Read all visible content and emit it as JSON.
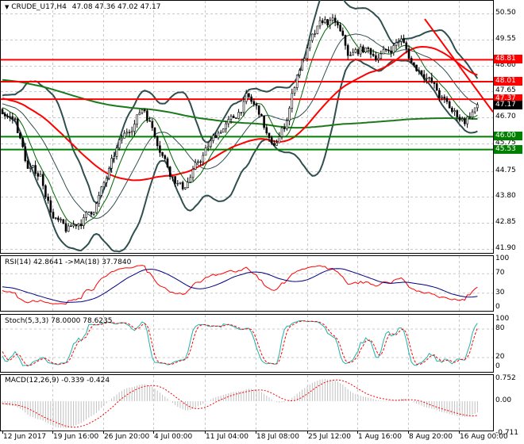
{
  "header": {
    "symbol": "CRUDE_U17,H4",
    "ohlc": "47.08 47.36 47.02 47.17",
    "menu_icon": "triangle-down-icon"
  },
  "price_axis": [
    "50.50",
    "49.55",
    "48.60",
    "47.65",
    "46.70",
    "45.75",
    "44.75",
    "43.80",
    "42.85",
    "41.90"
  ],
  "levels": [
    {
      "label": "48.81",
      "value": 48.81,
      "color": "#ff0000"
    },
    {
      "label": "48.01",
      "value": 48.01,
      "color": "#ff0000"
    },
    {
      "label": "47.37",
      "value": 47.37,
      "color": "#ff0000"
    },
    {
      "label": "46.00",
      "value": 46.0,
      "color": "#008000"
    },
    {
      "label": "45.53",
      "value": 45.53,
      "color": "#008000"
    }
  ],
  "current_price": {
    "label": "47.17",
    "value": 47.17
  },
  "rsi": {
    "title": "RSI(14) 42.8641  ->MA(18) 37.7840",
    "axis": [
      "100",
      "70",
      "30",
      "0"
    ]
  },
  "stoch": {
    "title": "Stoch(5,3,3) 78.0000 78.6235",
    "axis": [
      "100",
      "80",
      "20",
      "0"
    ]
  },
  "macd": {
    "title": "MACD(12,26,9) -0.339 -0.424",
    "axis": [
      "0.752",
      "0.00",
      "-0.711"
    ]
  },
  "time_axis": [
    "12 Jun 2017",
    "19 Jun 16:00",
    "26 Jun 20:00",
    "4 Jul 00:00",
    "11 Jul 04:00",
    "18 Jul 08:00",
    "25 Jul 12:00",
    "1 Aug 16:00",
    "8 Aug 20:00",
    "16 Aug 00:00"
  ],
  "chart_data": {
    "type": "candlestick",
    "symbol": "CRUDE_U17",
    "timeframe": "H4",
    "ylim": [
      41.9,
      50.5
    ],
    "close_path": [
      46.9,
      46.6,
      44.8,
      44.6,
      43.0,
      42.5,
      42.9,
      43.3,
      44.3,
      45.6,
      46.4,
      47.1,
      46.0,
      44.8,
      44.1,
      44.8,
      45.6,
      46.3,
      46.6,
      47.4,
      46.9,
      45.5,
      46.4,
      48.4,
      49.4,
      50.2,
      50.1,
      48.9,
      49.2,
      49.0,
      49.1,
      49.6,
      48.6,
      48.3,
      47.5,
      46.9,
      46.6,
      47.17
    ],
    "trendline": {
      "from": 50.3,
      "to": 46.9,
      "color": "#ff0000"
    },
    "colors": {
      "bands": "#2f4f4f",
      "ma_fast": "#006400",
      "ma_mid": "#ff0000",
      "ma_slow": "#1a7a1a",
      "rsi": "#ff0000",
      "rsi_ma": "#000080",
      "stoch_main": "#20b2aa",
      "stoch_signal": "#ff0000",
      "macd_hist": "#c0c0c0",
      "macd_signal": "#ff0000"
    }
  }
}
